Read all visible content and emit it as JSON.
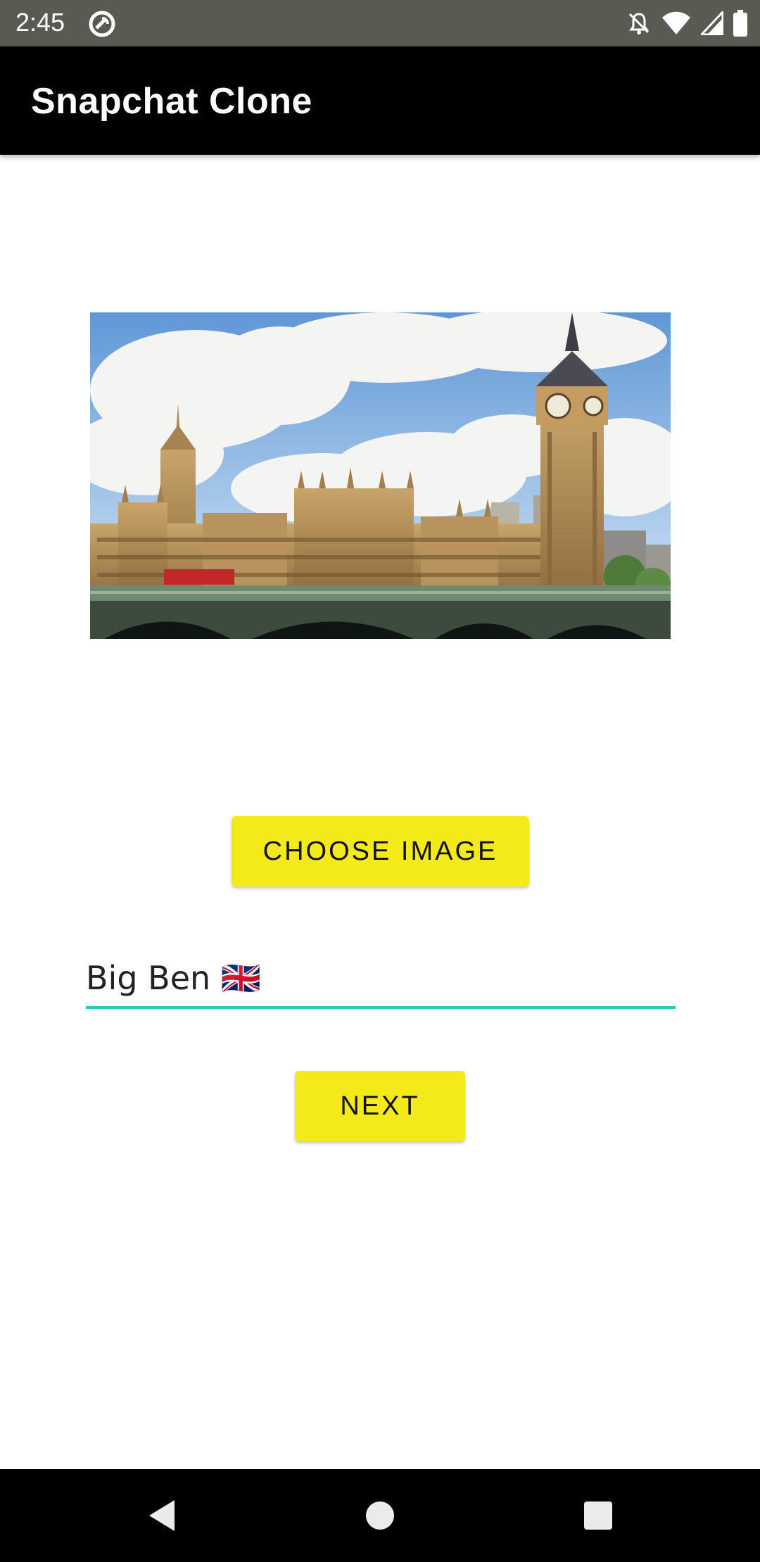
{
  "status_bar": {
    "time": "2:45",
    "left_icons": [
      "app-notification-icon"
    ],
    "right_icons": [
      "notifications-off-icon",
      "wifi-icon",
      "cell-signal-icon",
      "battery-icon"
    ]
  },
  "app_bar": {
    "title": "Snapchat Clone"
  },
  "photo": {
    "subject": "Big Ben and Westminster Bridge"
  },
  "buttons": {
    "choose_image": "CHOOSE IMAGE",
    "next": "NEXT"
  },
  "message_field": {
    "value": "Big Ben 🇬🇧",
    "underline_color": "#22ccbb"
  },
  "nav_bar": {
    "icons": [
      "back-icon",
      "home-icon",
      "recents-icon"
    ]
  },
  "colors": {
    "accent_button": "#f4ea1a",
    "app_bar": "#000000",
    "status_bar": "#5a5a52"
  }
}
